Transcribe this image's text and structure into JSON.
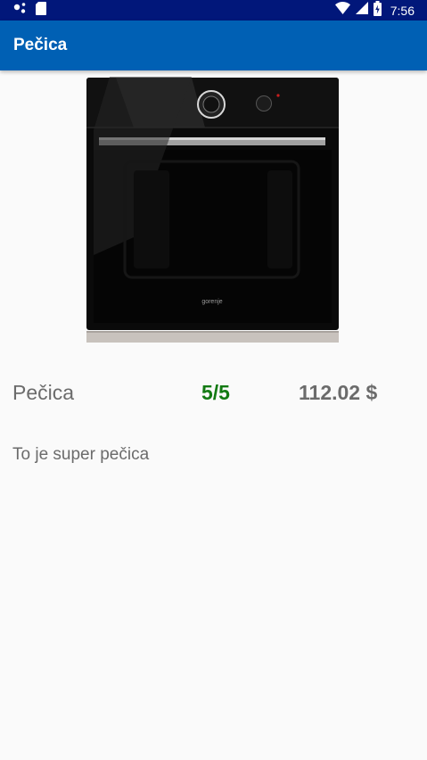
{
  "status_bar": {
    "time": "7:56",
    "icons": [
      "assistant-dots-icon",
      "sd-card-icon",
      "wifi-icon",
      "signal-icon",
      "battery-charging-icon"
    ]
  },
  "app_bar": {
    "title": "Pečica"
  },
  "product": {
    "image_brand": "gorenje",
    "name": "Pečica",
    "rating": "5/5",
    "price": "112.02 $",
    "description": "To je super pečica"
  },
  "colors": {
    "status_bar": "#01177a",
    "app_bar": "#0060b4",
    "rating": "#137a13",
    "text": "#6b6b6b",
    "background": "#fafafa"
  }
}
